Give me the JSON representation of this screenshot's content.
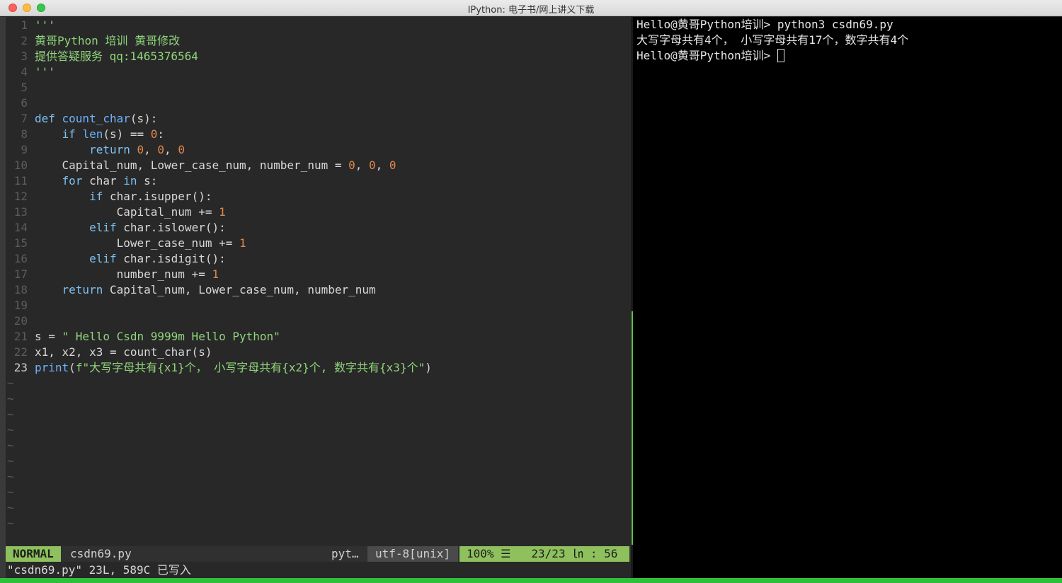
{
  "window": {
    "title": "IPython: 电子书/网上讲义下载"
  },
  "editor": {
    "lines": [
      {
        "n": "1",
        "parts": [
          [
            "cm",
            "'''"
          ]
        ]
      },
      {
        "n": "2",
        "parts": [
          [
            "cm",
            "黄哥Python 培训 黄哥修改"
          ]
        ]
      },
      {
        "n": "3",
        "parts": [
          [
            "cm",
            "提供答疑服务 qq:1465376564"
          ]
        ]
      },
      {
        "n": "4",
        "parts": [
          [
            "cm",
            "'''"
          ]
        ]
      },
      {
        "n": "5",
        "parts": []
      },
      {
        "n": "6",
        "parts": []
      },
      {
        "n": "7",
        "parts": [
          [
            "kw",
            "def "
          ],
          [
            "fn",
            "count_char"
          ],
          [
            "code",
            "(s):"
          ]
        ]
      },
      {
        "n": "8",
        "parts": [
          [
            "code",
            "    "
          ],
          [
            "kw",
            "if "
          ],
          [
            "fn",
            "len"
          ],
          [
            "code",
            "(s) == "
          ],
          [
            "num",
            "0"
          ],
          [
            "code",
            ":"
          ]
        ]
      },
      {
        "n": "9",
        "parts": [
          [
            "code",
            "        "
          ],
          [
            "kw",
            "return "
          ],
          [
            "num",
            "0"
          ],
          [
            "code",
            ", "
          ],
          [
            "num",
            "0"
          ],
          [
            "code",
            ", "
          ],
          [
            "num",
            "0"
          ]
        ]
      },
      {
        "n": "10",
        "parts": [
          [
            "code",
            "    Capital_num, Lower_case_num, number_num = "
          ],
          [
            "num",
            "0"
          ],
          [
            "code",
            ", "
          ],
          [
            "num",
            "0"
          ],
          [
            "code",
            ", "
          ],
          [
            "num",
            "0"
          ]
        ]
      },
      {
        "n": "11",
        "parts": [
          [
            "code",
            "    "
          ],
          [
            "kw",
            "for "
          ],
          [
            "code",
            "char "
          ],
          [
            "kw",
            "in "
          ],
          [
            "code",
            "s:"
          ]
        ]
      },
      {
        "n": "12",
        "parts": [
          [
            "code",
            "        "
          ],
          [
            "kw",
            "if "
          ],
          [
            "code",
            "char.isupper():"
          ]
        ]
      },
      {
        "n": "13",
        "parts": [
          [
            "code",
            "            Capital_num += "
          ],
          [
            "num",
            "1"
          ]
        ]
      },
      {
        "n": "14",
        "parts": [
          [
            "code",
            "        "
          ],
          [
            "kw",
            "elif "
          ],
          [
            "code",
            "char.islower():"
          ]
        ]
      },
      {
        "n": "15",
        "parts": [
          [
            "code",
            "            Lower_case_num += "
          ],
          [
            "num",
            "1"
          ]
        ]
      },
      {
        "n": "16",
        "parts": [
          [
            "code",
            "        "
          ],
          [
            "kw",
            "elif "
          ],
          [
            "code",
            "char.isdigit():"
          ]
        ]
      },
      {
        "n": "17",
        "parts": [
          [
            "code",
            "            number_num += "
          ],
          [
            "num",
            "1"
          ]
        ]
      },
      {
        "n": "18",
        "parts": [
          [
            "code",
            "    "
          ],
          [
            "kw",
            "return "
          ],
          [
            "code",
            "Capital_num, Lower_case_num, number_num"
          ]
        ]
      },
      {
        "n": "19",
        "parts": []
      },
      {
        "n": "20",
        "parts": []
      },
      {
        "n": "21",
        "parts": [
          [
            "code",
            "s = "
          ],
          [
            "str",
            "\" Hello Csdn 9999m Hello Python\""
          ]
        ]
      },
      {
        "n": "22",
        "parts": [
          [
            "code",
            "x1, x2, x3 = count_char(s)"
          ]
        ]
      },
      {
        "n": "23",
        "current": true,
        "parts": [
          [
            "fn",
            "print"
          ],
          [
            "code",
            "("
          ],
          [
            "str",
            "f\"大写字母共有{x1}个， 小写字母共有{x2}个, 数字共有{x3}个\""
          ],
          [
            "code",
            ")"
          ]
        ]
      }
    ],
    "empty_marker": "~",
    "empty_lines": 10,
    "status": {
      "mode": "NORMAL",
      "filename": "csdn69.py",
      "filetype": "pyt…",
      "encoding": "utf-8[unix]",
      "position": "100% ☰   23/23 ㏑ : 56"
    },
    "message": "\"csdn69.py\" 23L, 589C 已写入"
  },
  "terminal": {
    "lines": [
      "Hello@黄哥Python培训> python3 csdn69.py",
      "大写字母共有4个， 小写字母共有17个，数字共有4个"
    ],
    "prompt": "Hello@黄哥Python培训> "
  }
}
